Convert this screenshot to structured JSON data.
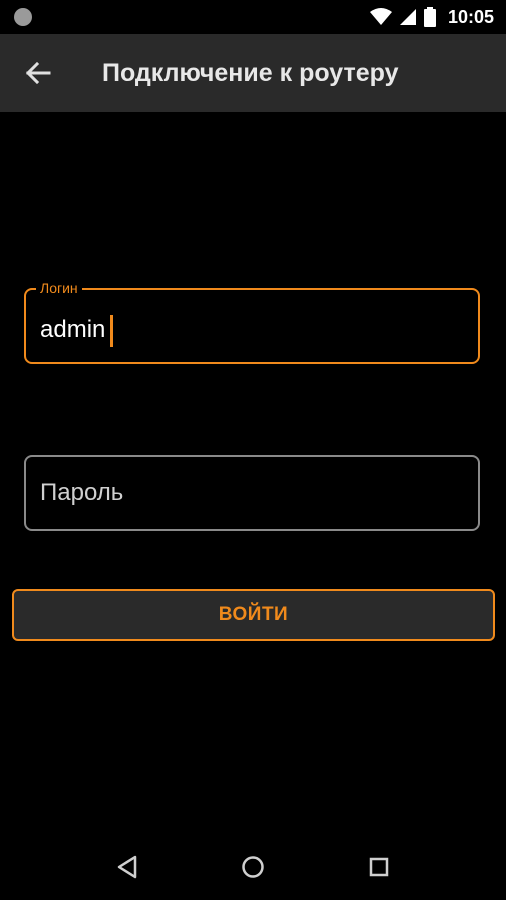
{
  "status_bar": {
    "time": "10:05",
    "icons": [
      "notification-dot-icon",
      "wifi-icon",
      "signal-icon",
      "battery-icon"
    ]
  },
  "app_bar": {
    "title": "Подключение к роутеру",
    "back_icon": "arrow-left-icon"
  },
  "form": {
    "login": {
      "label": "Логин",
      "value": "admin"
    },
    "password": {
      "placeholder": "Пароль",
      "value": ""
    },
    "submit_label": "ВОЙТИ"
  },
  "nav_bar": {
    "icons": [
      "back-triangle-icon",
      "home-circle-icon",
      "recents-square-icon"
    ]
  },
  "colors": {
    "accent": "#f08a1c",
    "app_bar": "#2a2a2a",
    "background": "#000000",
    "field_border_inactive": "#8a8a8a"
  }
}
